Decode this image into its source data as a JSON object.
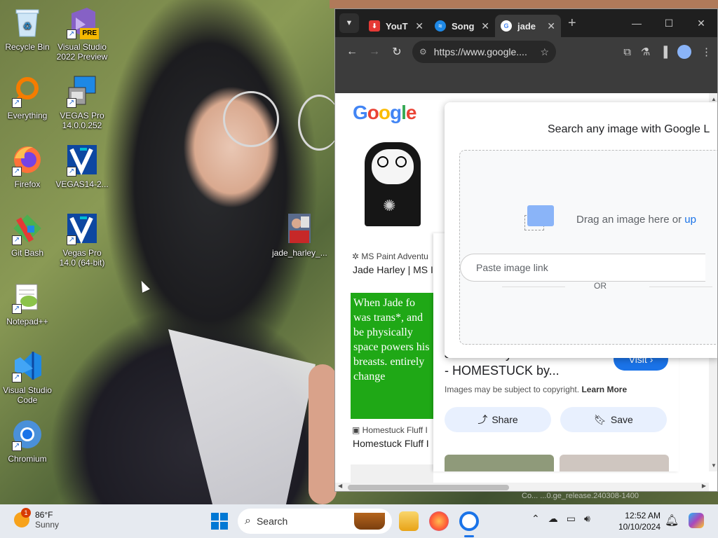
{
  "desktop": {
    "icons": [
      {
        "label": "Recycle Bin"
      },
      {
        "label": "Visual Studio 2022 Preview",
        "badge": "PRE"
      },
      {
        "label": "Everything"
      },
      {
        "label": "VEGAS Pro 14.0.0.252"
      },
      {
        "label": "Firefox"
      },
      {
        "label": "VEGAS14-2..."
      },
      {
        "label": "Git Bash"
      },
      {
        "label": "Vegas Pro 14.0 (64-bit)"
      },
      {
        "label": "jade_harley_..."
      },
      {
        "label": "Notepad++"
      },
      {
        "label": "Visual Studio Code"
      },
      {
        "label": "Chromium"
      }
    ]
  },
  "browser": {
    "tabs": [
      {
        "title": "YouT",
        "fav_color": "#e53935"
      },
      {
        "title": "Song",
        "fav_color": "#1e88e5"
      },
      {
        "title": "jade",
        "fav_color": "#ffffff"
      }
    ],
    "url": "https://www.google....",
    "status_text": "Co...  ...0.ge_release.240308-1400"
  },
  "page": {
    "logo": "Google",
    "results": [
      {
        "source": "MS Paint Adventu",
        "title": "Jade Harley | MS I"
      },
      {
        "source": "Homestuck Fluff I",
        "title": "Homestuck Fluff I",
        "image_text": "When Jade fo was trans*, and be physically space powers his breasts. entirely change"
      }
    ],
    "side_panel": {
      "title": "Jade Harley x Dave Strider - HOMESTUCK by...",
      "visit": "Visit",
      "copyright": "Images may be subject to copyright.",
      "learn_more": "Learn More",
      "share": "Share",
      "save": "Save"
    },
    "lens": {
      "heading": "Search any image with Google L",
      "drag": "Drag an image here or",
      "upload": "up",
      "or": "OR",
      "paste_placeholder": "Paste image link"
    }
  },
  "taskbar": {
    "weather_temp": "86°F",
    "weather_desc": "Sunny",
    "weather_badge": "1",
    "search_label": "Search",
    "time": "12:52 AM",
    "date": "10/10/2024"
  }
}
